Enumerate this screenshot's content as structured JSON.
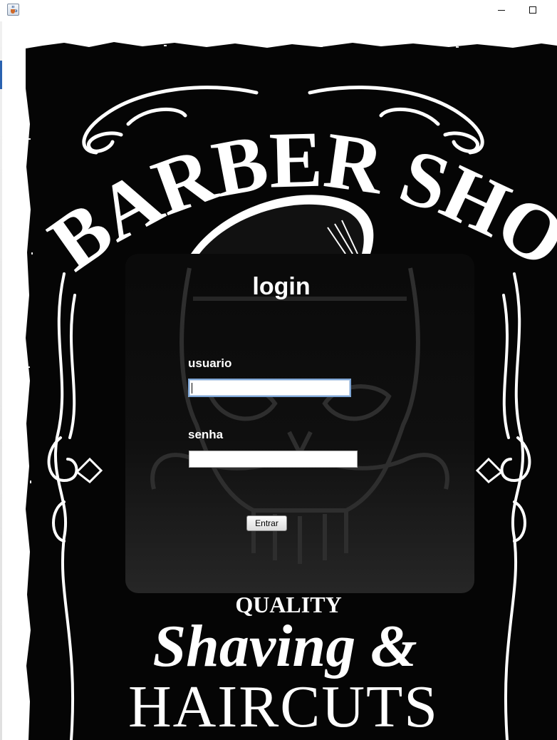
{
  "window": {
    "icon": "java-cup-icon",
    "controls": [
      "minimize-icon",
      "maximize-icon"
    ]
  },
  "poster": {
    "heading": "BARBER SHOP",
    "tagline_top": "QUALITY",
    "tagline_script": "Shaving &",
    "tagline_bottom": "HAIRCUTS",
    "colors": {
      "background": "#000000",
      "ink": "#ffffff"
    }
  },
  "login": {
    "title": "login",
    "username_label": "usuario",
    "username_value": "",
    "password_label": "senha",
    "password_value": "",
    "submit_label": "Entrar"
  }
}
